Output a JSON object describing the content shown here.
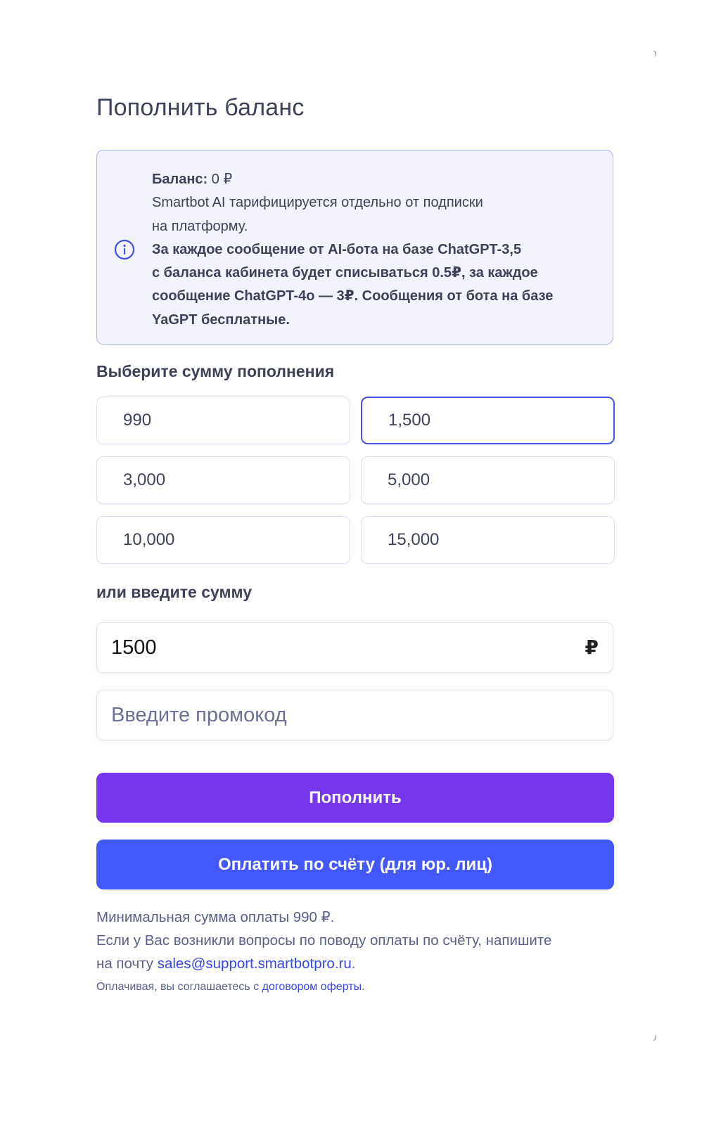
{
  "header": {
    "title": "Пополнить баланс"
  },
  "info": {
    "balance_label": "Баланс:",
    "balance_value": "0 ₽",
    "line1": "Smartbot AI тарифицируется отдельно от подписки",
    "line2": "на платформу.",
    "bold_line1": "За каждое сообщение от AI-бота на базе ChatGPT-3,5",
    "bold_line2": "с баланса кабинета будет списываться 0.5₽, за каждое",
    "bold_line3": "сообщение ChatGPT-4o — 3₽. Сообщения от бота на базе",
    "bold_line4": "YaGPT бесплатные.",
    "icon": "info-circle-icon",
    "icon_color": "#3f51e8"
  },
  "amounts": {
    "label": "Выберите сумму пополнения",
    "options": [
      "990",
      "1,500",
      "3,000",
      "5,000",
      "10,000",
      "15,000"
    ],
    "selected": "1,500"
  },
  "custom": {
    "label": "или введите сумму",
    "amount_value": "1500",
    "currency": "₽",
    "promo_placeholder": "Введите промокод"
  },
  "buttons": {
    "topup": "Пополнить",
    "invoice": "Оплатить по счёту (для юр. лиц)",
    "topup_color": "#7636ee",
    "invoice_color": "#4258fb"
  },
  "footer": {
    "min_amount": "Минимальная сумма оплаты 990 ₽.",
    "questions": "Если у Вас возникли вопросы по поводу оплаты по счёту, напишите",
    "email_prefix": "на почту ",
    "email": "sales@support.smartbotpro.ru",
    "email_suffix": ".",
    "agree_prefix": "Оплачивая, вы соглашаетесь с ",
    "agree_link": "договором оферты",
    "agree_suffix": "."
  }
}
